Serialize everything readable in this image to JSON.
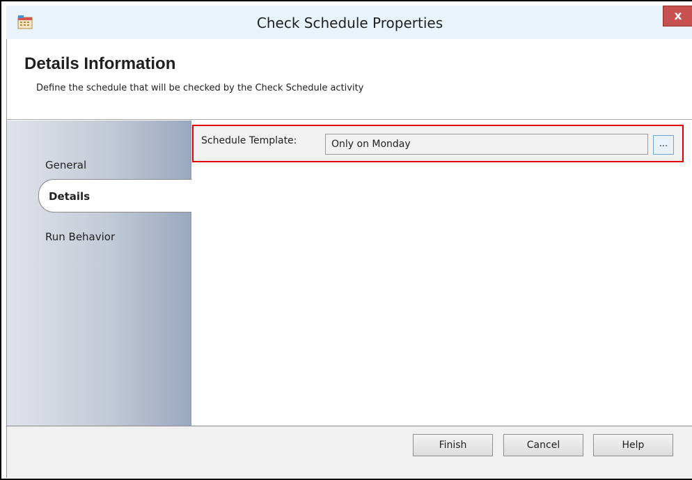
{
  "window": {
    "title": "Check Schedule Properties",
    "close_label": "x",
    "app_icon": "calendar-icon"
  },
  "header": {
    "title": "Details Information",
    "subtitle": "Define the schedule that will be checked by the Check Schedule activity"
  },
  "sidebar": {
    "items": [
      {
        "label": "General",
        "active": false
      },
      {
        "label": "Details",
        "active": true
      },
      {
        "label": "Run Behavior",
        "active": false
      }
    ]
  },
  "details": {
    "schedule_template_label": "Schedule Template:",
    "schedule_template_value": "Only on Monday",
    "browse_label": "..."
  },
  "footer": {
    "finish_label": "Finish",
    "cancel_label": "Cancel",
    "help_label": "Help"
  },
  "colors": {
    "highlight": "#e00000",
    "titlebar": "#e9f3fb",
    "close_button": "#c75050"
  }
}
